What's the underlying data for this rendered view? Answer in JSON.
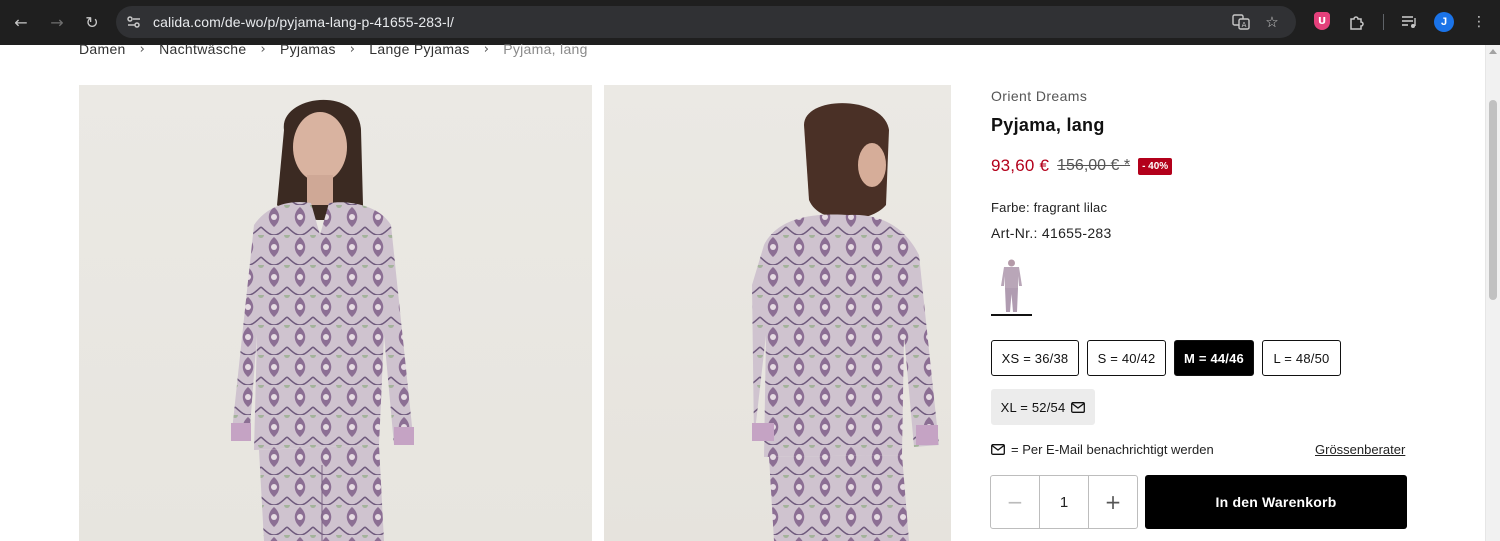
{
  "browser": {
    "url": "calida.com/de-wo/p/pyjama-lang-p-41655-283-l/",
    "avatar_initial": "J",
    "extension_badge": "U"
  },
  "breadcrumb": {
    "items": [
      "Damen",
      "Nachtwäsche",
      "Pyjamas",
      "Lange Pyjamas"
    ],
    "current": "Pyjama, lang"
  },
  "product": {
    "brand": "Orient Dreams",
    "title": "Pyjama, lang",
    "price_new": "93,60 €",
    "price_old": "156,00 € *",
    "discount_badge": "- 40%",
    "color_label": "Farbe: fragrant lilac",
    "article_number": "Art-Nr.: 41655-283",
    "sizes": [
      {
        "label": "XS = 36/38",
        "state": "available"
      },
      {
        "label": "S = 40/42",
        "state": "available"
      },
      {
        "label": "M = 44/46",
        "state": "selected"
      },
      {
        "label": "L = 48/50",
        "state": "available"
      },
      {
        "label": "XL = 52/54",
        "state": "unavailable"
      }
    ],
    "notify_text": "= Per E-Mail benachrichtigt werden",
    "size_advisor": "Grössenberater",
    "quantity": "1",
    "cart_button": "In den Warenkorb"
  },
  "colors": {
    "price_red": "#b3001b",
    "button_black": "#000000",
    "fabric_lilac": "#b39bbd"
  }
}
